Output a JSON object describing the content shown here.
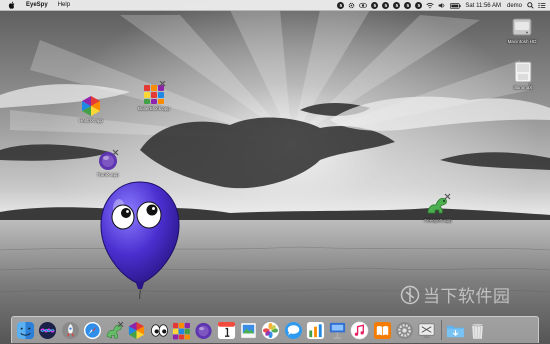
{
  "menubar": {
    "app_name": "EyeSpy",
    "menus": [
      "Help"
    ],
    "status_badges": [
      "5",
      "5",
      "5",
      "5",
      "5",
      "5"
    ],
    "clock": "Sat 11:56 AM",
    "user": "demo"
  },
  "desktop_icons": {
    "macintosh_hd": "Macintosh HD",
    "illuminax": "illuminaX",
    "hextrix": "HextriX.app",
    "ballerblock": "BallerBlock.app",
    "runix": "RuniX.app",
    "dino": "FeeeyeX.app"
  },
  "watermark": {
    "text": "当下软件园"
  },
  "dock": {
    "apps": [
      "finder",
      "siri",
      "launchpad",
      "safari",
      "dragon-app",
      "hextrix",
      "eyespy",
      "ballerblock",
      "runix",
      "calendar",
      "preview",
      "photos",
      "messages",
      "numbers",
      "keynote",
      "itunes",
      "ibooks",
      "system-preferences",
      "screenshot-utility"
    ],
    "stacks": [
      "downloads-folder",
      "trash"
    ]
  }
}
